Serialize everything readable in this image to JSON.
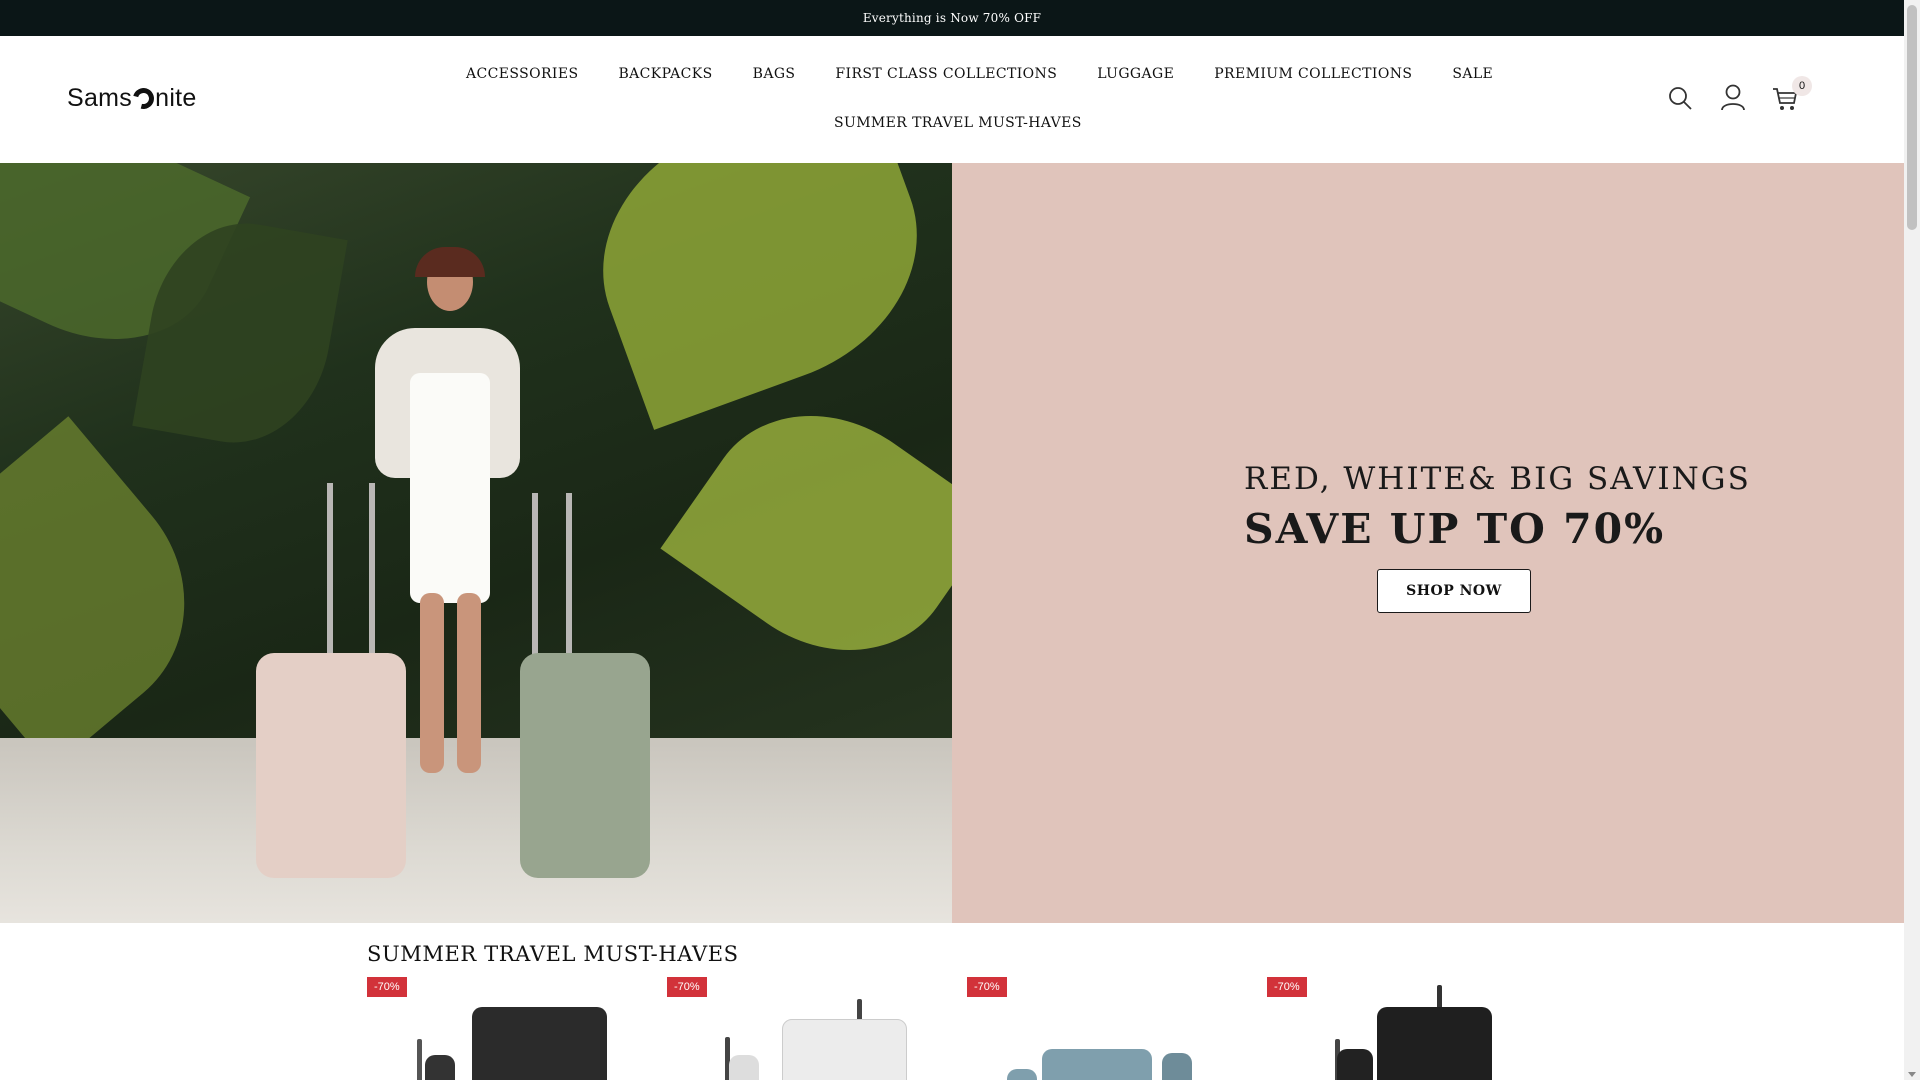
{
  "announcement": "Everything is Now 70% OFF",
  "brand": {
    "logo_text_left": "Sams",
    "logo_text_right": "nite"
  },
  "nav": {
    "items": [
      "ACCESSORIES",
      "BACKPACKS",
      "BAGS",
      "FIRST CLASS COLLECTIONS",
      "LUGGAGE",
      "PREMIUM COLLECTIONS",
      "SALE"
    ],
    "second_row": "SUMMER TRAVEL MUST-HAVES"
  },
  "header_icons": {
    "search": "search-icon",
    "account": "user-icon",
    "cart": "cart-icon",
    "cart_count": "0"
  },
  "hero": {
    "line1": "RED, WHITE& BIG SAVINGS",
    "line2": "SAVE UP TO 70%",
    "cta": "SHOP NOW",
    "panel_color": "#e0c4bb"
  },
  "section": {
    "title": "SUMMER TRAVEL MUST-HAVES",
    "products": [
      {
        "badge": "-70%",
        "color": "#2b2b2b"
      },
      {
        "badge": "-70%",
        "color": "#ececec"
      },
      {
        "badge": "-70%",
        "color": "#7f9fad"
      },
      {
        "badge": "-70%",
        "color": "#1f1f1f"
      }
    ]
  },
  "colors": {
    "announcement_bg": "#0b1617",
    "badge": "#d2323a"
  }
}
